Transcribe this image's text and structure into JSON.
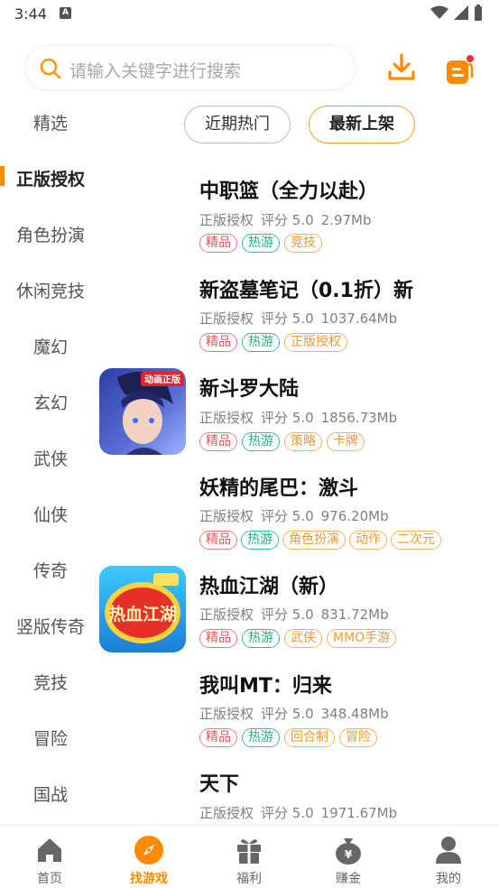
{
  "status": {
    "time": "3:44",
    "notif_icon": "A"
  },
  "search": {
    "placeholder": "请输入关键字进行搜索"
  },
  "sidebar": {
    "items": [
      {
        "label": "精选"
      },
      {
        "label": "正版授权"
      },
      {
        "label": "角色扮演"
      },
      {
        "label": "休闲竞技"
      },
      {
        "label": "魔幻"
      },
      {
        "label": "玄幻"
      },
      {
        "label": "武侠"
      },
      {
        "label": "仙侠"
      },
      {
        "label": "传奇"
      },
      {
        "label": "竖版传奇"
      },
      {
        "label": "竞技"
      },
      {
        "label": "冒险"
      },
      {
        "label": "国战"
      }
    ],
    "active": "正版授权"
  },
  "filters": {
    "recent": "近期热门",
    "newest": "最新上架"
  },
  "games": [
    {
      "name": "中职篮（全力以赴）",
      "source": "正版授权",
      "rating": "评分 5.0",
      "size": "2.97Mb",
      "tags": [
        [
          "精品",
          "red"
        ],
        [
          "热游",
          "green"
        ],
        [
          "竞技",
          "orange"
        ]
      ]
    },
    {
      "name": "新盗墓笔记（0.1折）新",
      "source": "正版授权",
      "rating": "评分 5.0",
      "size": "1037.64Mb",
      "tags": [
        [
          "精品",
          "red"
        ],
        [
          "热游",
          "green"
        ],
        [
          "正版授权",
          "orange"
        ]
      ]
    },
    {
      "name": "新斗罗大陆",
      "source": "正版授权",
      "rating": "评分 5.0",
      "size": "1856.73Mb",
      "tags": [
        [
          "精品",
          "red"
        ],
        [
          "热游",
          "green"
        ],
        [
          "策略",
          "orange"
        ],
        [
          "卡牌",
          "orange"
        ]
      ],
      "icon_badge": "动画正版"
    },
    {
      "name": "妖精的尾巴：激斗",
      "source": "正版授权",
      "rating": "评分 5.0",
      "size": "976.20Mb",
      "tags": [
        [
          "精品",
          "red"
        ],
        [
          "热游",
          "green"
        ],
        [
          "角色扮演",
          "orange"
        ],
        [
          "动作",
          "orange"
        ],
        [
          "二次元",
          "orange"
        ]
      ]
    },
    {
      "name": "热血江湖（新）",
      "source": "正版授权",
      "rating": "评分 5.0",
      "size": "831.72Mb",
      "tags": [
        [
          "精品",
          "red"
        ],
        [
          "热游",
          "green"
        ],
        [
          "武侠",
          "orange"
        ],
        [
          "MMO手游",
          "orange"
        ]
      ],
      "icon_text": "热血江湖"
    },
    {
      "name": "我叫MT：归来",
      "source": "正版授权",
      "rating": "评分 5.0",
      "size": "348.48Mb",
      "tags": [
        [
          "精品",
          "red"
        ],
        [
          "热游",
          "green"
        ],
        [
          "回合制",
          "orange"
        ],
        [
          "冒险",
          "orange"
        ]
      ]
    },
    {
      "name": "天下",
      "source": "正版授权",
      "rating": "评分 5.0",
      "size": "1971.67Mb",
      "tags": []
    }
  ],
  "tabbar": {
    "items": [
      {
        "label": "首页",
        "icon": "home-icon"
      },
      {
        "label": "找游戏",
        "icon": "compass-icon"
      },
      {
        "label": "福利",
        "icon": "gift-icon"
      },
      {
        "label": "赚金",
        "icon": "money-bag-icon"
      },
      {
        "label": "我的",
        "icon": "user-icon"
      }
    ],
    "active": "找游戏"
  },
  "colors": {
    "accent": "#ff8a00",
    "tag_red": "#f05555",
    "tag_green": "#15b87a",
    "tag_orange": "#f39a2e"
  }
}
